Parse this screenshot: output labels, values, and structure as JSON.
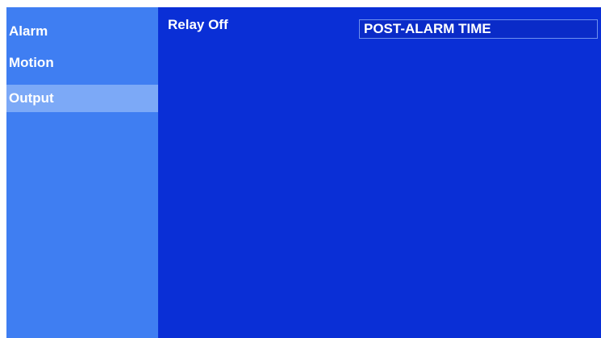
{
  "sidebar": {
    "items": [
      {
        "label": "Alarm"
      },
      {
        "label": "Motion"
      },
      {
        "label": "Output"
      }
    ],
    "selected": "Output"
  },
  "content": {
    "relay_label": "Relay Off",
    "relay_value": "POST-ALARM TIME"
  },
  "colors": {
    "background": "#0a2fd6",
    "sidebar": "#3f7ef2",
    "sidebar_active": "#7ca9f7",
    "text": "#ffffff"
  }
}
